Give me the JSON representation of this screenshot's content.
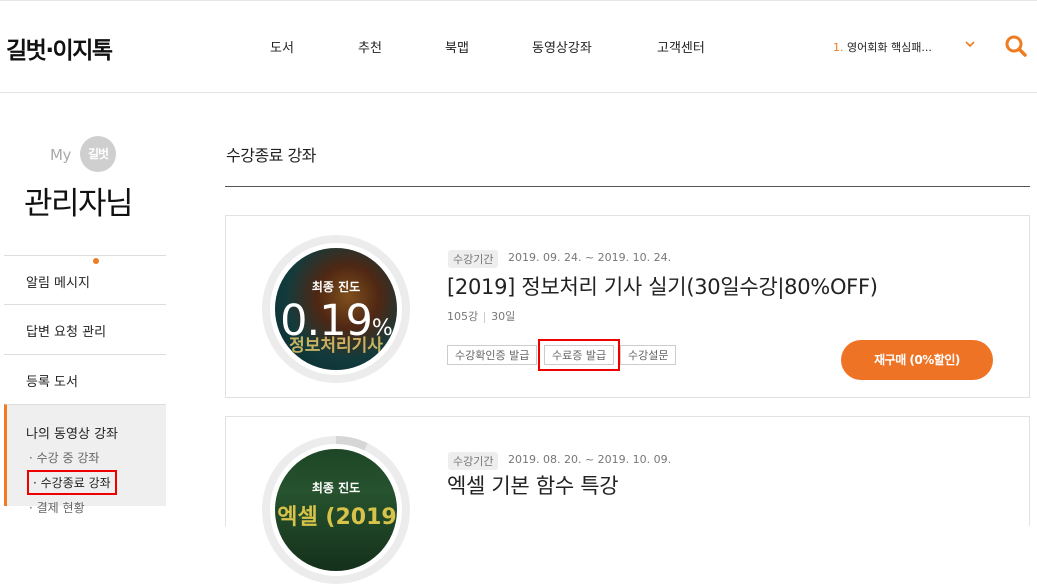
{
  "brand": {
    "logo": "길벗·이지톡"
  },
  "nav": {
    "items": [
      "도서",
      "추천",
      "북맵",
      "동영상강좌",
      "고객센터"
    ]
  },
  "ranking": {
    "number": "1.",
    "text": "영어회화 핵심패..."
  },
  "icons": {
    "search": "search-icon",
    "dropdown": "chevron-down-icon"
  },
  "colors": {
    "accent": "#ef7c21",
    "highlight": "#e00000"
  },
  "sidebar": {
    "my_prefix": "My",
    "my_badge": "길벗",
    "user_name": "관리자님",
    "items": [
      "알림 메시지",
      "답변 요청 관리",
      "등록 도서"
    ],
    "active_group": "나의 동영상 강좌",
    "sub_items": [
      "· 수강 중 강좌",
      "· 수강종료 강좌",
      "· 결제 현황"
    ]
  },
  "main": {
    "title": "수강종료 강좌",
    "courses": [
      {
        "period_label": "수강기간",
        "period": "2019. 09. 24. ~ 2019. 10. 24.",
        "title": "[2019] 정보처리 기사 실기(30일수강|80%OFF)",
        "lectures": "105강",
        "days": "30일",
        "progress_label": "최종 진도",
        "progress_value": "0.19",
        "progress_unit": "%",
        "progress_fraction": 0.0019,
        "thumb_text": "정보처리기사",
        "actions": [
          "수강확인증 발급",
          "수료증 발급",
          "수강설문"
        ],
        "rebuy_label": "재구매 (0%할인)"
      },
      {
        "period_label": "수강기간",
        "period": "2019. 08. 20. ~ 2019. 10. 09.",
        "title": "엑셀 기본 함수 특강",
        "progress_label": "최종 진도",
        "progress_value": "",
        "thumb_text": "엑셀 (2019"
      }
    ]
  }
}
